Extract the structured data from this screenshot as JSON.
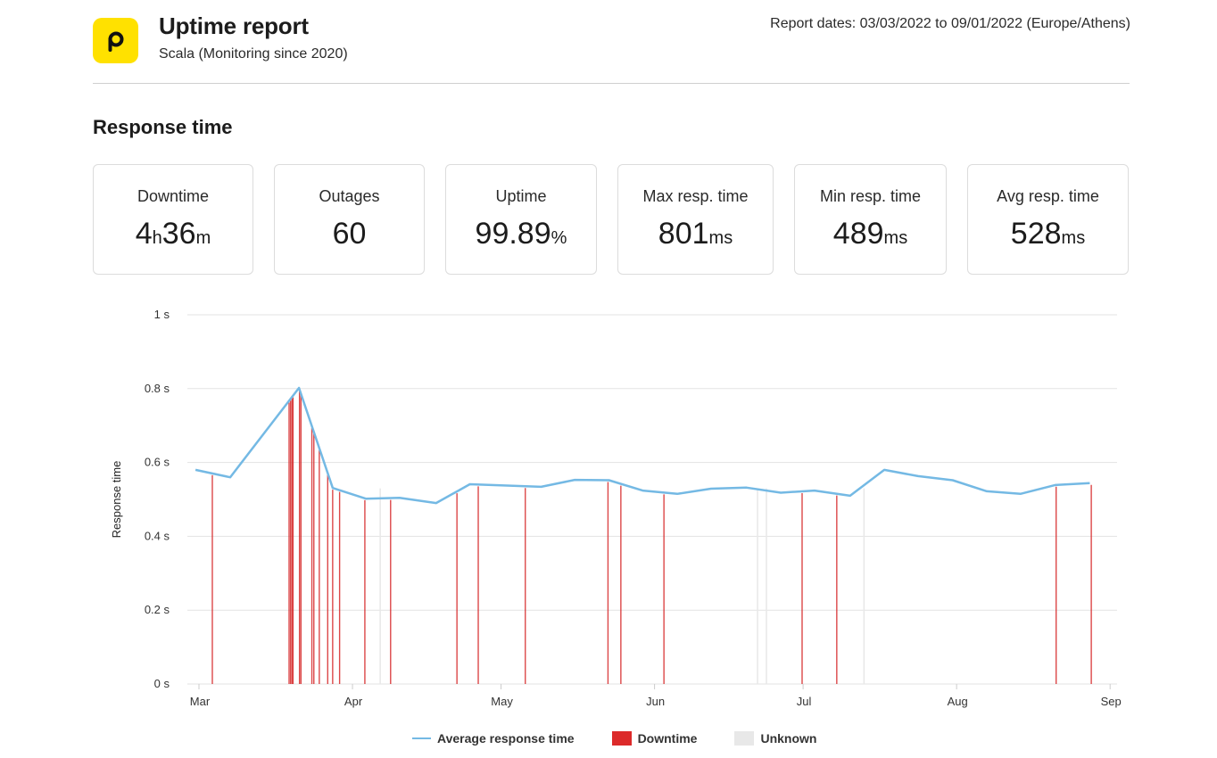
{
  "header": {
    "logo_letter": "p",
    "title": "Uptime report",
    "subtitle": "Scala (Monitoring since 2020)",
    "report_dates": "Report dates: 03/03/2022 to 09/01/2022 (Europe/Athens)"
  },
  "section_title": "Response time",
  "stats": [
    {
      "label": "Downtime",
      "parts": [
        {
          "t": "4",
          "u": false
        },
        {
          "t": "h",
          "u": true
        },
        {
          "t": "36",
          "u": false
        },
        {
          "t": "m",
          "u": true
        }
      ]
    },
    {
      "label": "Outages",
      "parts": [
        {
          "t": "60",
          "u": false
        }
      ]
    },
    {
      "label": "Uptime",
      "parts": [
        {
          "t": "99.89",
          "u": false
        },
        {
          "t": "%",
          "u": true
        }
      ]
    },
    {
      "label": "Max resp. time",
      "parts": [
        {
          "t": "801",
          "u": false
        },
        {
          "t": "ms",
          "u": true
        }
      ]
    },
    {
      "label": "Min resp. time",
      "parts": [
        {
          "t": "489",
          "u": false
        },
        {
          "t": "ms",
          "u": true
        }
      ]
    },
    {
      "label": "Avg resp. time",
      "parts": [
        {
          "t": "528",
          "u": false
        },
        {
          "t": "ms",
          "u": true
        }
      ]
    }
  ],
  "colors": {
    "brand_yellow": "#ffe100",
    "line": "#74b9e4",
    "downtime": "#d62728",
    "unknown": "#e8e8e8",
    "grid": "#e3e3e3"
  },
  "chart_data": {
    "type": "line",
    "title": "",
    "xlabel": "",
    "ylabel": "Response time",
    "ylim": [
      0,
      1
    ],
    "y_ticks": [
      {
        "v": 0,
        "label": "0  s"
      },
      {
        "v": 0.2,
        "label": "0.2  s"
      },
      {
        "v": 0.4,
        "label": "0.4  s"
      },
      {
        "v": 0.6,
        "label": "0.6  s"
      },
      {
        "v": 0.8,
        "label": "0.8  s"
      },
      {
        "v": 1,
        "label": "1  s"
      }
    ],
    "x_unit": "days since Mar 1, 2022",
    "xlim": [
      -2,
      184
    ],
    "x_ticks": [
      {
        "v": 0,
        "label": "Mar"
      },
      {
        "v": 31,
        "label": "Apr"
      },
      {
        "v": 61,
        "label": "May"
      },
      {
        "v": 92,
        "label": "Jun"
      },
      {
        "v": 122,
        "label": "Jul"
      },
      {
        "v": 153,
        "label": "Aug"
      },
      {
        "v": 184,
        "label": "Sep"
      }
    ],
    "grid": true,
    "legend_position": "bottom",
    "series": [
      {
        "name": "Average response time",
        "x": [
          -0.7,
          6.3,
          20.2,
          27,
          33.7,
          40.5,
          47.9,
          54.7,
          69.1,
          75.9,
          82.8,
          89.6,
          96.6,
          103.4,
          110.6,
          117.5,
          124.3,
          131.5,
          138.4,
          145.2,
          152.2,
          159.1,
          165.9,
          172.9,
          179.9
        ],
        "values": [
          0.58,
          0.56,
          0.802,
          0.531,
          0.502,
          0.504,
          0.49,
          0.541,
          0.534,
          0.553,
          0.552,
          0.524,
          0.515,
          0.529,
          0.532,
          0.518,
          0.524,
          0.51,
          0.58,
          0.563,
          0.552,
          0.522,
          0.515,
          0.539,
          0.544
        ]
      }
    ],
    "downtime_events": [
      2.7,
      18.2,
      18.5,
      18.8,
      19.0,
      20.3,
      20.6,
      22.8,
      23.2,
      24.3,
      26.0,
      27.0,
      28.4,
      33.5,
      38.7,
      52.1,
      56.4,
      65.9,
      82.6,
      85.2,
      93.9,
      121.8,
      128.8,
      173.1,
      180.2
    ],
    "unknown_events": [
      36.6,
      112.8,
      114.6,
      134.3
    ],
    "legend": [
      {
        "name": "Average response time",
        "kind": "line"
      },
      {
        "name": "Downtime",
        "kind": "box"
      },
      {
        "name": "Unknown",
        "kind": "box"
      }
    ]
  }
}
